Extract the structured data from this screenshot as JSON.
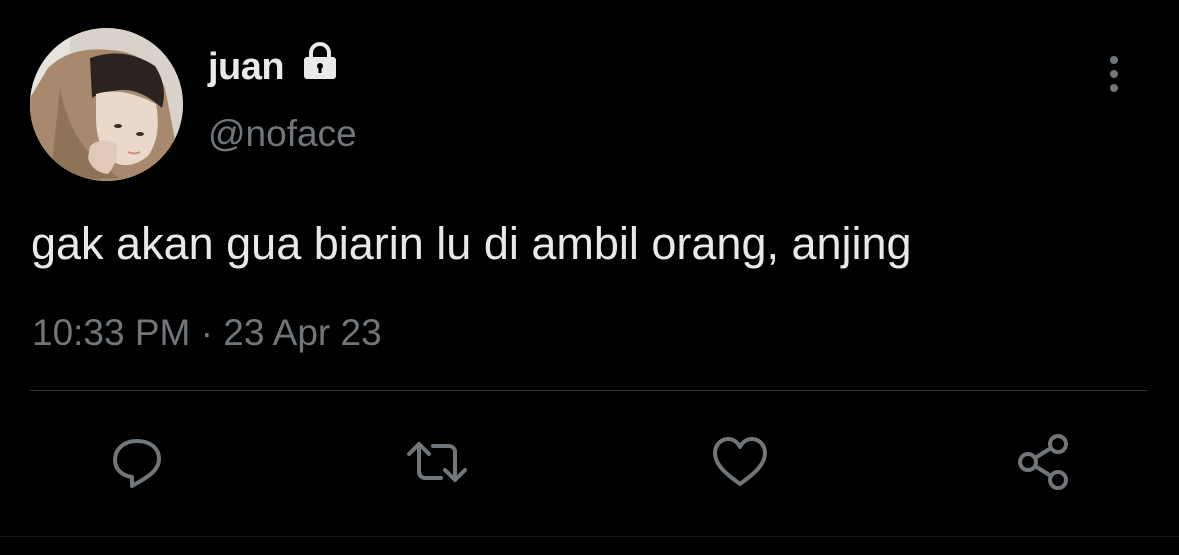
{
  "user": {
    "display_name": "juan",
    "handle": "@noface",
    "avatar_icon": "profile-photo",
    "protected_icon": "lock-icon"
  },
  "tweet": {
    "text": "gak akan gua biarin lu di ambil orang, anjing",
    "timestamp": "10:33 PM · 23 Apr 23"
  },
  "actions": [
    {
      "name": "reply",
      "icon": "reply-icon"
    },
    {
      "name": "retweet",
      "icon": "retweet-icon"
    },
    {
      "name": "like",
      "icon": "heart-icon"
    },
    {
      "name": "share",
      "icon": "share-icon"
    }
  ],
  "colors": {
    "background": "#000000",
    "primary_text": "#e7e9ea",
    "secondary_text": "#71767b",
    "divider": "#2f3336"
  }
}
